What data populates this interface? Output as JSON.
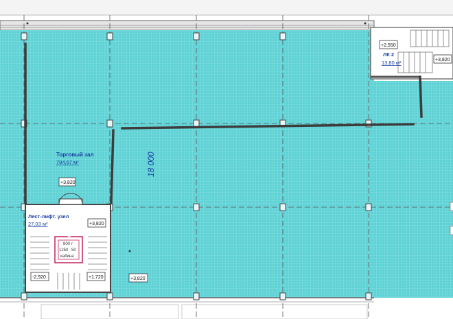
{
  "rooms": {
    "sales_hall": {
      "name": "Торговый зал",
      "area": "794,67 м²"
    },
    "stair_lift": {
      "name": "Лест-лифт. узел",
      "area": "27,03 м²"
    },
    "lk2": {
      "name": "ЛК 2",
      "area": "13,80 м²"
    }
  },
  "dimension": {
    "value": "18 000"
  },
  "levels": {
    "hall_door": "+3,820",
    "stair_top": "+3,820",
    "stair_bottom_left": "-2,920",
    "stair_mid": "+1,720",
    "hall_floor": "+3,820",
    "lk2_left": "+2,550",
    "lk2_right": "+3,820"
  },
  "elevator": {
    "line1": "800",
    "line2": "1250",
    "line3": "кабина",
    "side1": "г",
    "side2": "50"
  },
  "colors": {
    "floor": "#5fd2d6",
    "floor_grid": "#9fe6e8",
    "wall": "#444444",
    "axis": "#555555",
    "text_blue": "#1a3fa0"
  }
}
